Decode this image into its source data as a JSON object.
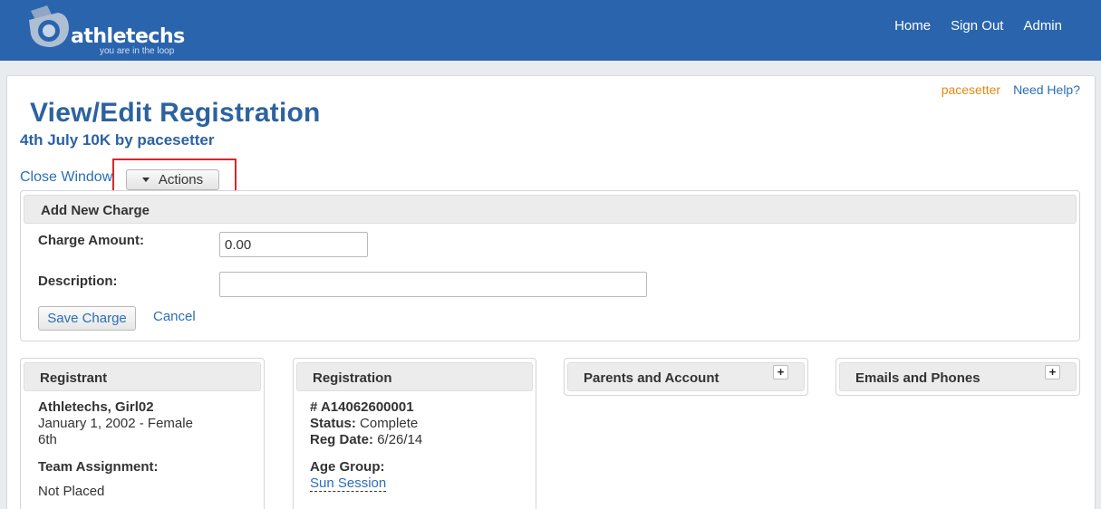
{
  "brand": {
    "name": "athletechs",
    "tagline": "you are in the loop",
    "color": "#2a64ad"
  },
  "nav": {
    "items": [
      "Home",
      "Sign Out",
      "Admin"
    ]
  },
  "top_links": {
    "user": "pacesetter",
    "help": "Need Help?"
  },
  "page": {
    "title": "View/Edit Registration",
    "subtitle": "4th July 10K by pacesetter"
  },
  "toolbar": {
    "close_label": "Close Window",
    "actions_label": "Actions",
    "actions_icon": "caret-down-icon"
  },
  "charge_form": {
    "heading": "Add New Charge",
    "amount_label": "Charge Amount:",
    "amount_value": "0.00",
    "description_label": "Description:",
    "description_value": "",
    "save_label": "Save Charge",
    "cancel_label": "Cancel"
  },
  "registrant": {
    "heading": "Registrant",
    "name": "Athletechs, Girl02",
    "dob_gender": "January 1, 2002 - Female",
    "grade": "6th",
    "team_label": "Team Assignment:",
    "team_value": "Not Placed"
  },
  "registration": {
    "heading": "Registration",
    "number": "# A14062600001",
    "status_label": "Status:",
    "status_value": "Complete",
    "reg_date_label": "Reg Date:",
    "reg_date_value": "6/26/14",
    "age_group_label": "Age Group:",
    "age_group_value": "Sun Session"
  },
  "parents_panel": {
    "heading": "Parents and Account",
    "expand_icon": "plus-icon"
  },
  "emails_panel": {
    "heading": "Emails and Phones",
    "expand_icon": "plus-icon"
  },
  "colors": {
    "accent": "#2d62a0",
    "link": "#2a6eb8",
    "user_link": "#e28a12",
    "highlight": "#d9262b"
  }
}
